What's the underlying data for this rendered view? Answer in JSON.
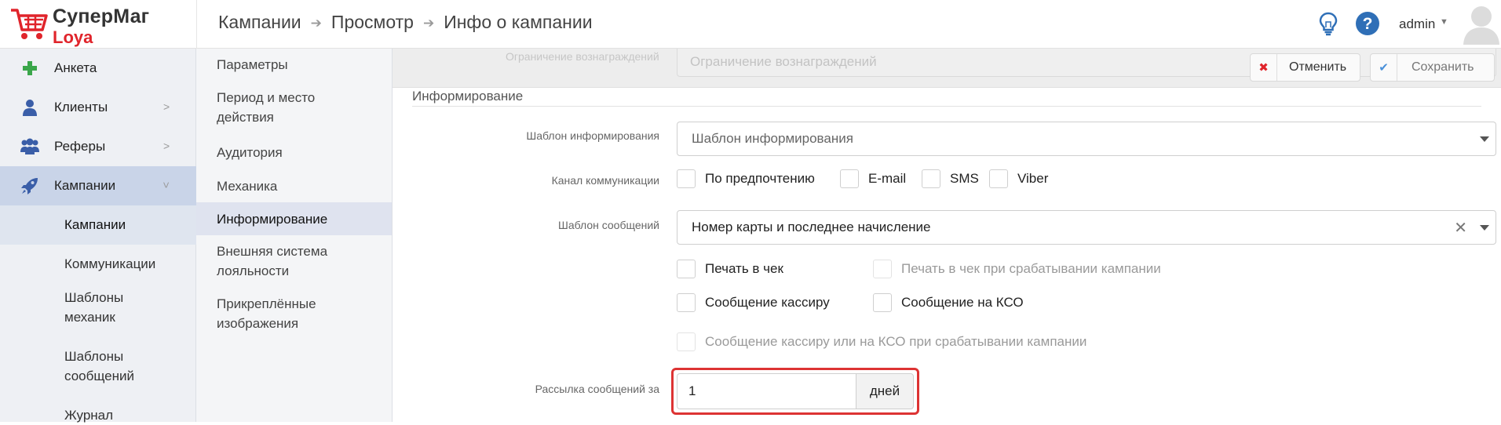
{
  "logo": {
    "title": "СуперМаг",
    "subtitle": "Loya"
  },
  "header": {
    "breadcrumb": [
      "Кампании",
      "Просмотр",
      "Инфо о кампании"
    ],
    "user": "admin"
  },
  "sidebar": {
    "items": [
      {
        "label": "Анкета",
        "icon": "plus-icon"
      },
      {
        "label": "Клиенты",
        "icon": "user-icon"
      },
      {
        "label": "Реферы",
        "icon": "users-icon"
      },
      {
        "label": "Кампании",
        "icon": "rocket-icon"
      }
    ],
    "sub_items": [
      "Кампании",
      "Коммуникации",
      "Шаблоны механик",
      "Шаблоны сообщений",
      "Журнал"
    ]
  },
  "section_nav": {
    "items": [
      "Параметры",
      "Период и место действия",
      "Аудитория",
      "Механика",
      "Информирование",
      "Внешняя система лояльности",
      "Прикреплённые изображения"
    ]
  },
  "form": {
    "dimmed_label": "Ограничение вознаграждений",
    "dimmed_placeholder": "Ограничение вознаграждений",
    "cancel_label": "Отменить",
    "save_label": "Сохранить",
    "section_title": "Информирование",
    "template_label": "Шаблон информирования",
    "template_placeholder": "Шаблон информирования",
    "channel_label": "Канал коммуникации",
    "channels": [
      "По предпочтению",
      "E-mail",
      "SMS",
      "Viber"
    ],
    "message_template_label": "Шаблон сообщений",
    "message_template_value": "Номер карты и последнее начисление",
    "print_receipt": "Печать в чек",
    "print_receipt_trigger": "Печать в чек при срабатывании кампании",
    "cashier_message": "Сообщение кассиру",
    "kso_message": "Сообщение на КСО",
    "cashier_or_kso_trigger": "Сообщение кассиру или на КСО при срабатывании кампании",
    "mailing_label": "Рассылка сообщений за",
    "mailing_value": "1",
    "mailing_unit": "дней"
  },
  "colors": {
    "accent_red": "#e0242b",
    "active_nav": "#c9d4e8",
    "highlight_frame": "#dd3333"
  }
}
